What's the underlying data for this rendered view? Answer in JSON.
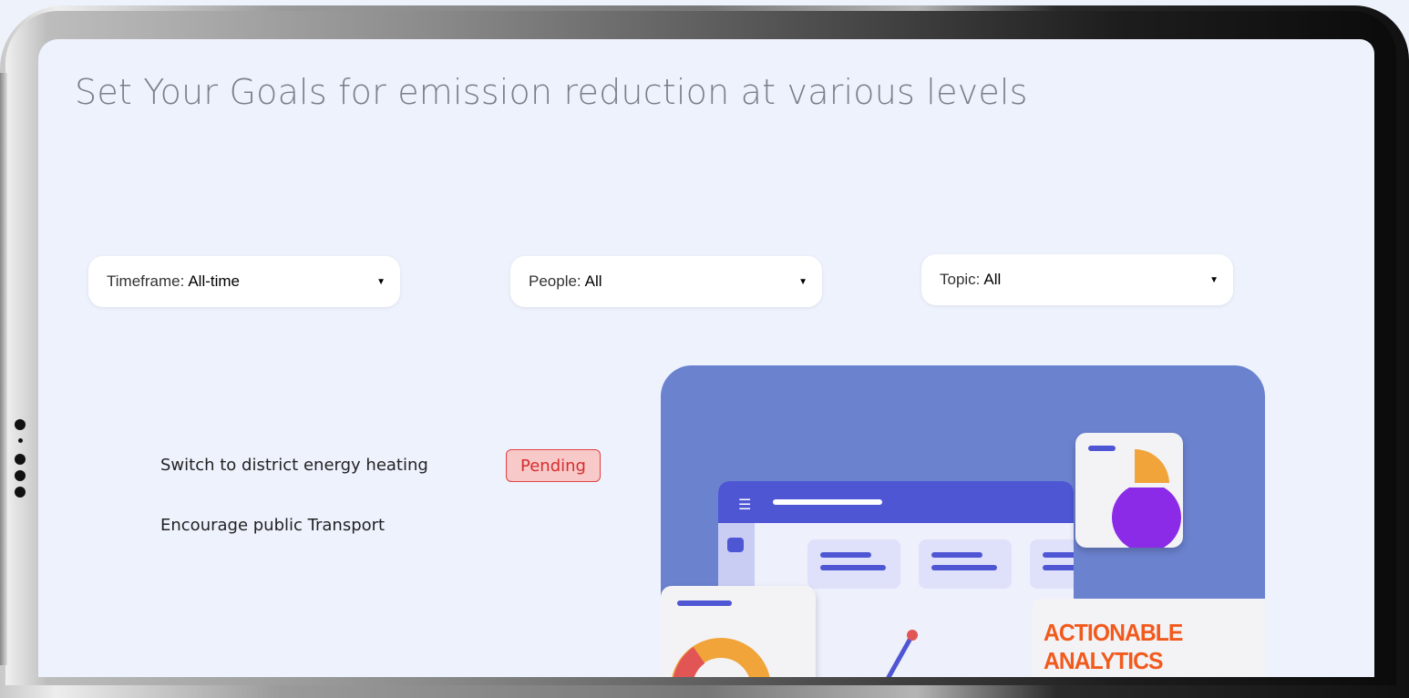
{
  "page": {
    "title": "Set Your Goals for emission reduction at various levels"
  },
  "filters": [
    {
      "label": "Timeframe:",
      "value": "All-time"
    },
    {
      "label": "People:",
      "value": "All"
    },
    {
      "label": "Topic:",
      "value": "All"
    }
  ],
  "goals": [
    {
      "text": "Switch to district energy heating",
      "status": "Pending"
    },
    {
      "text": "Encourage public Transport"
    }
  ],
  "illustration": {
    "banner_text": "ACTIONABLE ANALYTICS",
    "colors": {
      "background": "#6b82cf",
      "primary": "#4e56d4",
      "accent": "#f25a1d",
      "pie_purple": "#8b2be8",
      "pie_orange": "#f0a43a"
    }
  },
  "icons": {
    "menu": "hamburger-icon",
    "dropdown": "caret-down-icon",
    "pie": "pie-chart-icon",
    "donut": "donut-chart-icon"
  }
}
